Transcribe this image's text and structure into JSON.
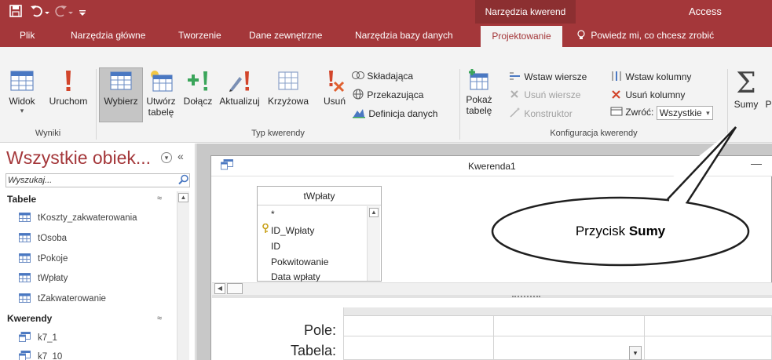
{
  "titlebar": {
    "context_tab_header": "Narzędzia kwerend",
    "app_title": "Access"
  },
  "tabs": [
    "Plik",
    "Narzędzia główne",
    "Tworzenie",
    "Dane zewnętrzne",
    "Narzędzia bazy danych",
    "Projektowanie"
  ],
  "tell_me": "Powiedz mi, co chcesz zrobić",
  "ribbon": {
    "widok": "Widok",
    "uruchom": "Uruchom",
    "group_wyniki": "Wyniki",
    "wybierz": "Wybierz",
    "utworz_line1": "Utwórz",
    "utworz_line2": "tabelę",
    "dolacz": "Dołącz",
    "aktualizuj": "Aktualizuj",
    "krzyzowa": "Krzyżowa",
    "usun": "Usuń",
    "skladajaca": "Składająca",
    "przekazujaca": "Przekazująca",
    "definicja": "Definicja danych",
    "group_typ": "Typ kwerendy",
    "pokaz_line1": "Pokaż",
    "pokaz_line2": "tabelę",
    "wstaw_wiersze": "Wstaw wiersze",
    "usun_wiersze": "Usuń wiersze",
    "konstruktor": "Konstruktor",
    "wstaw_kolumny": "Wstaw kolumny",
    "usun_kolumny": "Usuń kolumny",
    "zwroc_label": "Zwróć:",
    "zwroc_value": "Wszystkie",
    "group_konfig": "Konfiguracja kwerendy",
    "sumy": "Sumy"
  },
  "nav": {
    "title": "Wszystkie obiek...",
    "search_placeholder": "Wyszukaj...",
    "section_tables": "Tabele",
    "tables": [
      "tKoszty_zakwaterowania",
      "tOsoba",
      "tPokoje",
      "tWpłaty",
      "tZakwaterowanie"
    ],
    "section_queries": "Kwerendy",
    "queries": [
      "k7_1",
      "k7_10"
    ]
  },
  "query_window": {
    "title": "Kwerenda1",
    "table_name": "tWpłaty",
    "fields": [
      "*",
      "ID_Wpłaty",
      "ID",
      "Pokwitowanie",
      "Data wpłaty"
    ],
    "row_labels": [
      "Pole:",
      "Tabela:"
    ]
  },
  "callout": {
    "text_prefix": "Przycisk ",
    "text_bold": "Sumy"
  }
}
